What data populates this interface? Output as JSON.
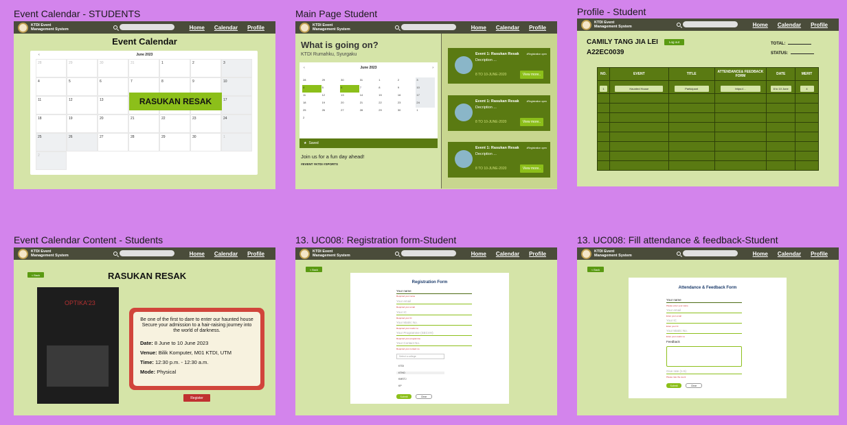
{
  "nav": {
    "logo_text": "KTDI Event\nManagement System",
    "links": [
      "Home",
      "Calendar",
      "Profile"
    ]
  },
  "frames": {
    "f1": "Event Calendar - STUDENTS",
    "f2": "Main Page Student",
    "f3": "Profile - Student",
    "f4": "Event Calendar Content - Students",
    "f5": "13. UC008: Registration form-Student",
    "f6": "13. UC008: Fill attendance & feedback-Student"
  },
  "calendar": {
    "heading": "Event Calendar",
    "month": "June 2023",
    "prev": "‹",
    "event_label": "RASUKAN RESAK",
    "days": [
      "28",
      "29",
      "30",
      "31",
      "1",
      "2",
      "3",
      "4",
      "5",
      "6",
      "7",
      "8",
      "9",
      "10",
      "11",
      "12",
      "13",
      "14",
      "15",
      "16",
      "17",
      "18",
      "19",
      "20",
      "21",
      "22",
      "23",
      "24",
      "25",
      "26",
      "27",
      "28",
      "29",
      "30",
      "1",
      "2"
    ]
  },
  "main": {
    "heading": "What is going on?",
    "location": "KTDI Rumahku, Syurgaku",
    "month": "June 2023",
    "saved": "Saved",
    "join": "Join us for a fun day ahead!",
    "tags": "#EVENT #KTDI #SPORTS",
    "cards": [
      {
        "title": "Event 1: Rasukan Resak",
        "tag": "#Registration open",
        "desc": "Decription ...",
        "date": "8 TO 10-JUNE-2020",
        "button": "View more.."
      },
      {
        "title": "Event 1: Rasukan Resak",
        "tag": "#Registration open",
        "desc": "Decription ...",
        "date": "8 TO 10-JUNE-2020",
        "button": "View more.."
      },
      {
        "title": "Event 1: Rasukan Resak",
        "tag": "#Registration open",
        "desc": "Decription ...",
        "date": "8 TO 10-JUNE-2020",
        "button": "View more.."
      }
    ]
  },
  "profile": {
    "name": "CAMILY TANG JIA LEI",
    "id": "A22EC0039",
    "logout": "Log out",
    "total": "TOTAL:",
    "status": "STATUS:",
    "headers": [
      "NO.",
      "EVENT",
      "TITLE",
      "ATTENDANCE& FEEDBACK FORM",
      "DATE",
      "MERIT"
    ],
    "row": [
      "1",
      "Haunted House",
      "Participant",
      "https://...",
      "8 to 10 June",
      "4"
    ]
  },
  "content": {
    "back": "< Back",
    "title": "RASUKAN RESAK",
    "poster_title": "OPTIKA'23",
    "description": "Be one of the first to dare to enter our haunted house Secure your admission to a hair-raising journey into the world of darkness.",
    "date_label": "Date:",
    "date_value": "8 June to 10 June 2023",
    "venue_label": "Venue:",
    "venue_value": "Bilik Komputer, M01 KTDI, UTM",
    "time_label": "Time:",
    "time_value": "12:30 p.m. - 12:30 a.m.",
    "mode_label": "Mode:",
    "mode_value": "Physical",
    "register": "Register"
  },
  "reg_form": {
    "back": "< Back",
    "title": "Registration Form",
    "fields": [
      "Your name",
      "Your email",
      "Your IC",
      "Your Matric No.",
      "Your Programme (SECVH)",
      "Your Contact No."
    ],
    "errors": [
      "Required your name",
      "Required your email",
      "Required your IC",
      "Required your matric no",
      "Required your programme",
      "Required your contact no"
    ],
    "select_placeholder": "Select a college",
    "options": [
      "KTDI",
      "KTHO",
      "KMSTJ",
      "KP"
    ],
    "submit": "Submit",
    "clear": "Clear"
  },
  "att_form": {
    "back": "< Back",
    "title": "Attendance & Feedback Form",
    "fields": [
      "Your name",
      "Your email",
      "Your IC",
      "Your Matric No."
    ],
    "errors": [
      "Please enter your name",
      "Enter your email",
      "Enter your IC",
      "Enter your matric no"
    ],
    "feedback_label": "Feedback",
    "extra_field": "Give rate (1-5)",
    "extra_error": "Please rate the event",
    "submit": "Submit",
    "clear": "Clear"
  },
  "colors": {
    "nav": "#4a4c3a",
    "frame_bg": "#d5e4a8",
    "accent": "#8cbf1a",
    "dark_green": "#5a7a12",
    "red": "#d1453b"
  }
}
